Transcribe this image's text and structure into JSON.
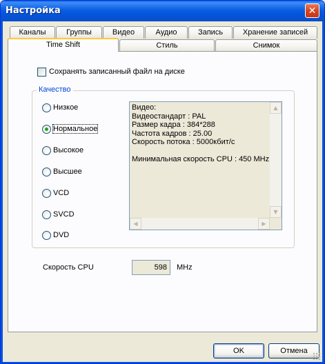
{
  "window": {
    "title": "Настройка"
  },
  "tabs": {
    "row1": [
      "Каналы",
      "Группы",
      "Видео",
      "Аудио",
      "Запись",
      "Хранение записей"
    ],
    "row2": [
      "Time Shift",
      "Стиль",
      "Снимок"
    ]
  },
  "timeshift": {
    "save_file_label": "Сохранять записанный файл на диске",
    "quality_legend": "Качество",
    "quality_options": [
      "Низкое",
      "Нормальное",
      "Высокое",
      "Высшее",
      "VCD",
      "SVCD",
      "DVD"
    ],
    "selected_quality": "Нормальное",
    "info_lines": [
      "Видео:",
      "Видеостандарт : PAL",
      "Размер кадра : 384*288",
      "Частота кадров : 25.00",
      "Скорость потока : 5000кбит/с",
      "",
      "Минимальная скорость CPU : 450 MHz"
    ],
    "cpu_label": "Скорость CPU",
    "cpu_value": "598",
    "cpu_unit": "MHz"
  },
  "buttons": {
    "ok": "OK",
    "cancel": "Отмена"
  },
  "colors": {
    "titlebar": "#0a5fe6",
    "active_tab_accent": "#ffc73c",
    "group_legend": "#0046d5",
    "radio_dot": "#21a121"
  }
}
